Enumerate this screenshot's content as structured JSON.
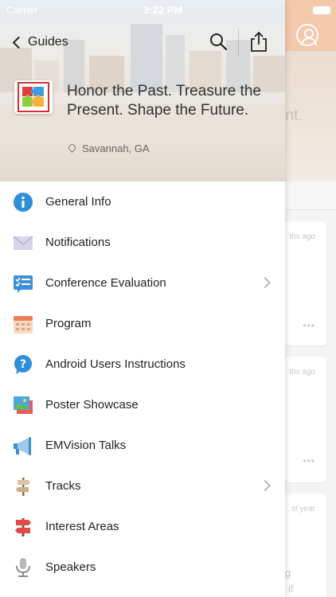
{
  "status": {
    "carrier": "Carrier",
    "time": "3:22 PM"
  },
  "header": {
    "back_label": "Guides",
    "title": "Honor the Past. Treasure the Present. Shape the Future.",
    "location": "Savannah, GA"
  },
  "menu": [
    {
      "label": "General Info",
      "icon": "info-icon",
      "has_chevron": false
    },
    {
      "label": "Notifications",
      "icon": "envelope-icon",
      "has_chevron": false
    },
    {
      "label": "Conference Evaluation",
      "icon": "checklist-icon",
      "has_chevron": true
    },
    {
      "label": "Program",
      "icon": "calendar-icon",
      "has_chevron": false
    },
    {
      "label": "Android Users Instructions",
      "icon": "help-icon",
      "has_chevron": false
    },
    {
      "label": "Poster Showcase",
      "icon": "picture-icon",
      "has_chevron": false
    },
    {
      "label": "EMVision Talks",
      "icon": "megaphone-icon",
      "has_chevron": false
    },
    {
      "label": "Tracks",
      "icon": "signpost-icon",
      "has_chevron": true
    },
    {
      "label": "Interest Areas",
      "icon": "direction-sign-icon",
      "has_chevron": false
    },
    {
      "label": "Speakers",
      "icon": "microphone-icon",
      "has_chevron": false
    }
  ],
  "background": {
    "header_fragment": "nt.",
    "timestamps": [
      "ths ago",
      "ths ago",
      "st year"
    ],
    "fragments": [
      "g",
      "if"
    ]
  },
  "colors": {
    "accent_header": "#f3c8ab",
    "info_blue": "#2e8fd8",
    "chevron_gray": "#b8b8b8"
  }
}
